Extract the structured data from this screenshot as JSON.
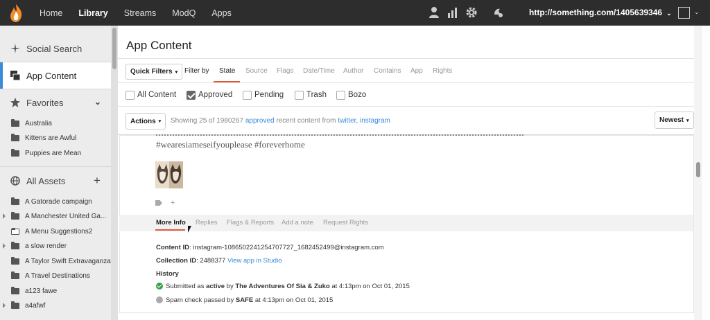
{
  "topbar": {
    "nav": [
      "Home",
      "Library",
      "Streams",
      "ModQ",
      "Apps"
    ],
    "active": "Library",
    "icons": [
      "user-icon",
      "stats-icon",
      "gear-icon",
      "notifications-icon"
    ],
    "url": "http://something.com/1405639346"
  },
  "sidebar": {
    "top_items": [
      {
        "label": "Social Search",
        "icon": "sparkle-icon"
      },
      {
        "label": "App Content",
        "icon": "app-content-icon",
        "active": true
      },
      {
        "label": "Favorites",
        "icon": "star-icon"
      }
    ],
    "favorites": [
      "Australia",
      "Kittens are Awful",
      "Puppies are Mean"
    ],
    "all_assets_label": "All Assets",
    "assets": [
      "A Gatorade campaign",
      "A Manchester United Ga...",
      "A Menu Suggestions2",
      "a slow render",
      "A Taylor Swift Extravaganza",
      "A Travel Destinations",
      "a123 fawe",
      "a4afwf"
    ]
  },
  "main": {
    "title": "App Content",
    "quick_filters": "Quick Filters",
    "filter_by": "Filter by",
    "tabs": [
      "State",
      "Source",
      "Flags",
      "Date/Time",
      "Author",
      "Contains",
      "App",
      "Rights"
    ],
    "active_tab": "State",
    "checkboxes": [
      {
        "label": "All Content",
        "checked": false
      },
      {
        "label": "Approved",
        "checked": true
      },
      {
        "label": "Pending",
        "checked": false
      },
      {
        "label": "Trash",
        "checked": false
      },
      {
        "label": "Bozo",
        "checked": false
      }
    ],
    "actions": "Actions",
    "showing_prefix": "Showing 25 of 1980267",
    "showing_state": "approved",
    "showing_mid": "recent content from",
    "showing_sources": "twitter, instagram",
    "sort": "Newest"
  },
  "item": {
    "hashtags": "#wearesiameseifyouplease #foreverhome",
    "plus": "+",
    "subtabs": [
      "More Info",
      "Replies",
      "Flags & Reports",
      "Add a note",
      "Request Rights"
    ],
    "active_subtab": "More Info",
    "content_id_label": "Content ID",
    "content_id": ": instagram-1086502241254707727_1682452499@instagram.com",
    "collection_id_label": "Collection ID",
    "collection_id": ": 2488377",
    "view_app": "View app in Studio",
    "history_label": "History",
    "history": [
      {
        "pre": "Submitted as ",
        "b1": "active",
        "mid": " by ",
        "b2": "The Adventures Of Sia & Zuko",
        "post": " at 4:13pm on Oct 01, 2015"
      },
      {
        "pre": "Spam check passed by ",
        "b1": "SAFE",
        "post": " at 4:13pm on Oct 01, 2015"
      }
    ]
  },
  "colors": {
    "accent": "#e05a3a",
    "link": "#3a8bd8",
    "topbar": "#2d2d2d"
  }
}
